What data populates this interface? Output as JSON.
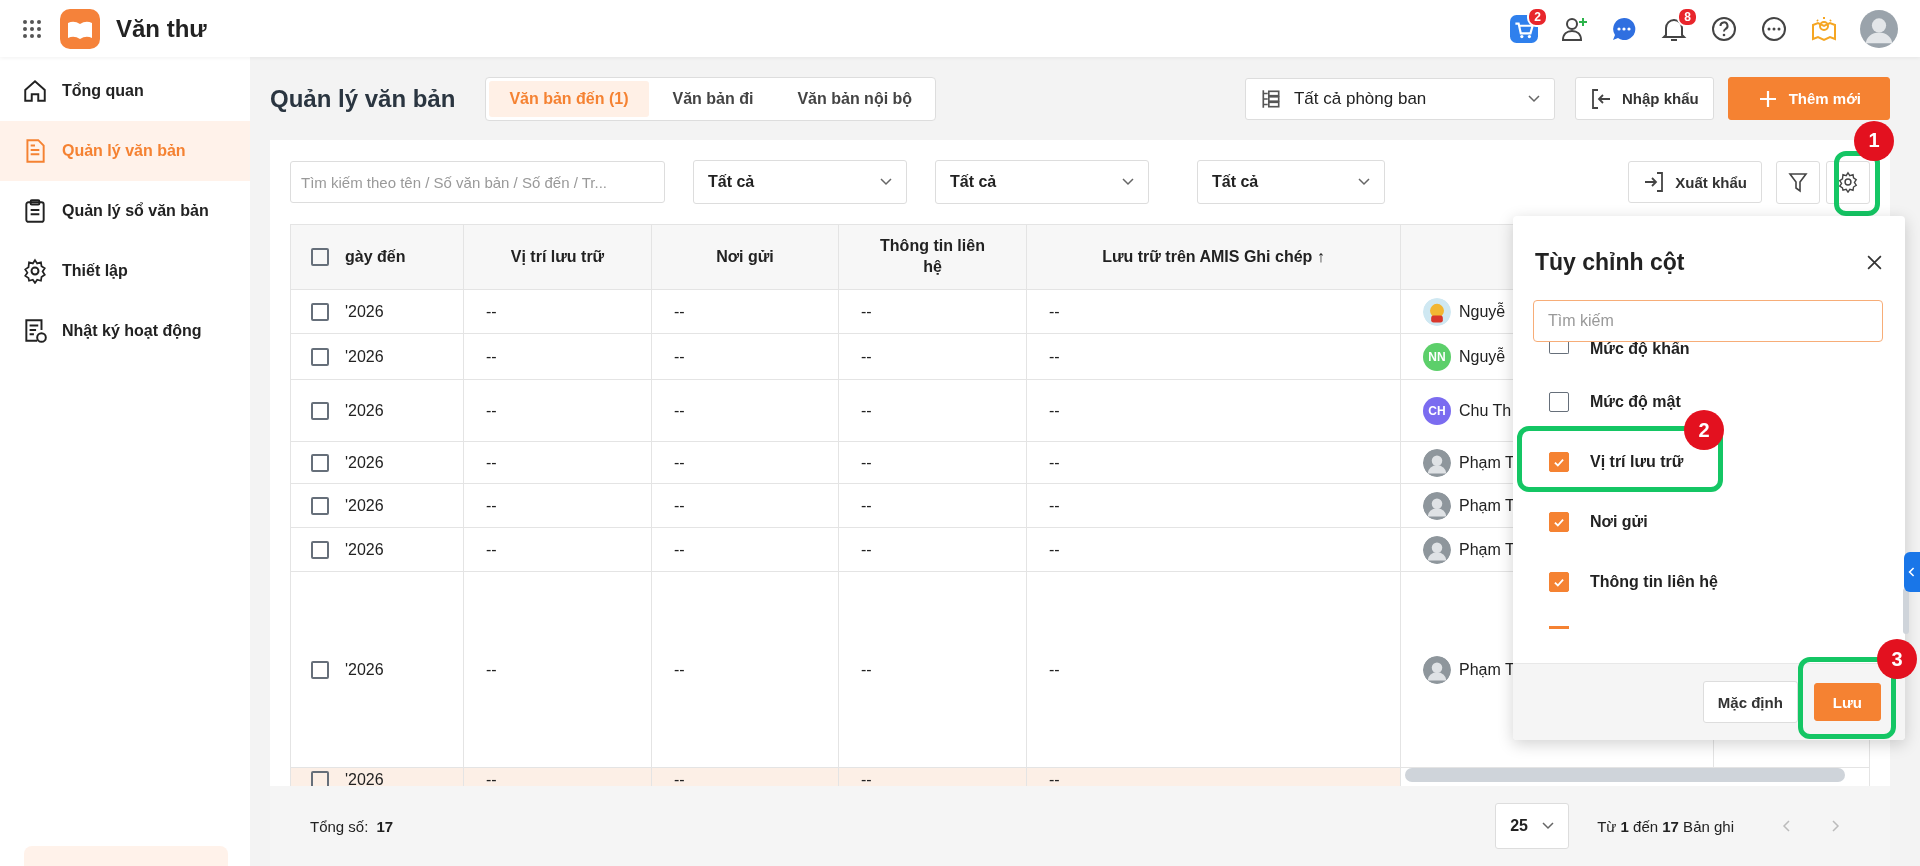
{
  "app": {
    "title": "Văn thư"
  },
  "topbar": {
    "icons": [
      {
        "kind": "cart",
        "badge": "2"
      },
      {
        "kind": "user-add"
      },
      {
        "kind": "chat"
      },
      {
        "kind": "bell",
        "badge": "8"
      },
      {
        "kind": "help"
      },
      {
        "kind": "more"
      },
      {
        "kind": "idea"
      },
      {
        "kind": "avatar"
      }
    ]
  },
  "sidebar": {
    "items": [
      {
        "kind": "home",
        "label": "Tổng quan",
        "selected": false
      },
      {
        "kind": "doc",
        "label": "Quản lý văn bản",
        "selected": true
      },
      {
        "kind": "clipboard",
        "label": "Quản lý sổ văn bản",
        "selected": false
      },
      {
        "kind": "gear",
        "label": "Thiết lập",
        "selected": false
      },
      {
        "kind": "log",
        "label": "Nhật ký hoạt động",
        "selected": false
      }
    ]
  },
  "page": {
    "title": "Quản lý văn bản",
    "tabs": [
      {
        "label": "Văn bản đến (1)",
        "selected": true
      },
      {
        "label": "Văn bản đi",
        "selected": false
      },
      {
        "label": "Văn bản nội bộ",
        "selected": false
      }
    ],
    "department": "Tất cả phòng ban",
    "import_button": "Nhập khẩu",
    "add_button": "Thêm mới"
  },
  "filters": {
    "search_placeholder": "Tìm kiếm theo tên / Số văn bản / Số đến / Tr...",
    "selects": [
      "Tất cả",
      "Tất cả",
      "Tất cả"
    ],
    "export_button": "Xuất khẩu",
    "settings_callout": "1"
  },
  "table": {
    "select_all_checked": false,
    "columns": [
      "gày đến",
      "Vị trí lưu trữ",
      "Nơi gửi",
      "Thông tin liên\nhệ",
      "Lưu trữ trên AMIS Ghi chép ↑"
    ],
    "rows": [
      {
        "checked": false,
        "hovered": false,
        "cells": [
          "'2026",
          "--",
          "--",
          "--",
          "--"
        ],
        "person": {
          "kind": "picture",
          "name": "Nguyễ"
        }
      },
      {
        "checked": false,
        "hovered": false,
        "cells": [
          "'2026",
          "--",
          "--",
          "--",
          "--"
        ],
        "person": {
          "kind": "initials",
          "initials": "NN",
          "color": "#5ccf6a",
          "name": "Nguyễ"
        }
      },
      {
        "checked": false,
        "hovered": false,
        "cells": [
          "'2026",
          "--",
          "--",
          "--",
          "--"
        ],
        "person": {
          "kind": "initials",
          "initials": "CH",
          "color": "#7b6cf0",
          "name": "Chu Th"
        }
      },
      {
        "checked": false,
        "hovered": false,
        "cells": [
          "'2026",
          "--",
          "--",
          "--",
          "--"
        ],
        "person": {
          "kind": "photo",
          "name": "Phạm T"
        }
      },
      {
        "checked": false,
        "hovered": false,
        "cells": [
          "'2026",
          "--",
          "--",
          "--",
          "--"
        ],
        "person": {
          "kind": "photo",
          "name": "Phạm T"
        }
      },
      {
        "checked": false,
        "hovered": false,
        "cells": [
          "'2026",
          "--",
          "--",
          "--",
          "--"
        ],
        "person": {
          "kind": "photo",
          "name": "Phạm T"
        }
      },
      {
        "checked": false,
        "hovered": false,
        "cells": [
          "'2026",
          "--",
          "--",
          "--",
          "--"
        ],
        "person": {
          "kind": "photo",
          "name": "Phạm T"
        }
      },
      {
        "checked": false,
        "hovered": true,
        "cells": [
          "'2026",
          "--",
          "--",
          "--",
          "--"
        ]
      }
    ]
  },
  "footer": {
    "total_label": "Tổng số:",
    "total": "17",
    "page_size": "25",
    "range": "Từ **1** đến **17** Bản ghi"
  },
  "panel": {
    "title": "Tùy chỉnh cột",
    "search_placeholder": "Tìm kiếm",
    "items": [
      {
        "label": "Mức độ khẩn",
        "checked": false
      },
      {
        "label": "Mức độ mật",
        "checked": false
      },
      {
        "label": "Vị trí lưu trữ",
        "checked": true,
        "callout": "2"
      },
      {
        "label": "Nơi gửi",
        "checked": true
      },
      {
        "label": "Thông tin liên hệ",
        "checked": true
      }
    ],
    "default_button": "Mặc định",
    "save_button": "Lưu",
    "save_callout": "3"
  }
}
